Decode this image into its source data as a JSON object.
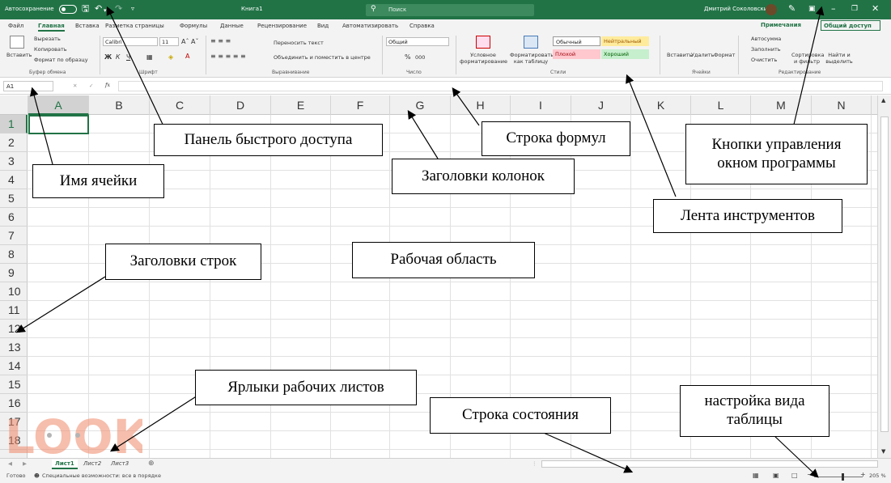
{
  "titlebar": {
    "autosave_label": "Автосохранение",
    "workbook_title": "Книга1",
    "search_placeholder": "Поиск",
    "user_name": "Дмитрий Соколовский"
  },
  "tabs": [
    "Файл",
    "Главная",
    "Вставка",
    "Разметка страницы",
    "Формулы",
    "Данные",
    "Рецензирование",
    "Вид",
    "Автоматизировать",
    "Справка"
  ],
  "tabs_right": {
    "notes": "Примечания",
    "share": "Общий доступ"
  },
  "ribbon": {
    "clipboard": {
      "paste": "Вставить",
      "cut": "Вырезать",
      "copy": "Копировать",
      "format_painter": "Формат по образцу",
      "group": "Буфер обмена"
    },
    "font": {
      "name": "Calibri",
      "size": "11",
      "bold": "Ж",
      "italic": "К",
      "underline": "Ч",
      "group": "Шрифт"
    },
    "alignment": {
      "wrap": "Переносить текст",
      "merge": "Объединить и поместить в центре",
      "group": "Выравнивание"
    },
    "number": {
      "format": "Общий",
      "percent": "%",
      "thousands": "000",
      "group": "Число"
    },
    "styles": {
      "conditional": "Условное форматирование",
      "as_table": "Форматировать как таблицу",
      "normal": "Обычный",
      "neutral": "Нейтральный",
      "bad": "Плохой",
      "good": "Хороший",
      "group": "Стили"
    },
    "cells": {
      "insert": "Вставить",
      "delete": "Удалить",
      "format": "Формат",
      "group": "Ячейки"
    },
    "editing": {
      "autosum": "Автосумма",
      "fill": "Заполнить",
      "clear": "Очистить",
      "sort": "Сортировка и фильтр",
      "find": "Найти и выделить",
      "group": "Редактирование"
    }
  },
  "formula_bar": {
    "name_box": "A1",
    "fx": "fx"
  },
  "columns": [
    "A",
    "B",
    "C",
    "D",
    "E",
    "F",
    "G",
    "H",
    "I",
    "J",
    "K",
    "L",
    "M",
    "N"
  ],
  "rows": [
    "1",
    "2",
    "3",
    "4",
    "5",
    "6",
    "7",
    "8",
    "9",
    "10",
    "11",
    "12",
    "13",
    "14",
    "15",
    "16",
    "17",
    "18"
  ],
  "sheets": [
    "Лист1",
    "Лист2",
    "Лист3"
  ],
  "status": {
    "ready": "Готово",
    "accessibility": "Специальные возможности: все в порядке",
    "zoom": "205 %"
  },
  "callouts": {
    "quick_access": "Панель быстрого доступа",
    "formula_bar": "Строка формул",
    "window_controls_1": "Кнопки управления",
    "window_controls_2": "окном программы",
    "cell_name": "Имя ячейки",
    "column_headers": "Заголовки колонок",
    "ribbon": "Лента инструментов",
    "row_headers": "Заголовки строк",
    "work_area": "Рабочая область",
    "sheet_tabs": "Ярлыки рабочих листов",
    "status_bar": "Строка состояния",
    "view_settings_1": "настройка вида",
    "view_settings_2": "таблицы"
  },
  "watermark": "LOOK",
  "colors": {
    "excel_green": "#217346",
    "neutral_fill": "#ffeb9c",
    "bad_fill": "#ffc7ce",
    "good_fill": "#c6efce"
  }
}
